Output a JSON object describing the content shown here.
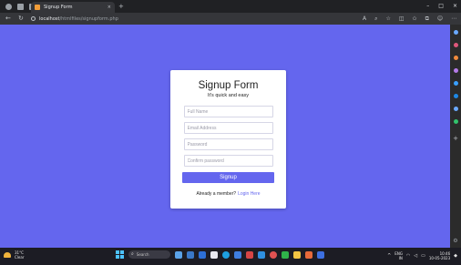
{
  "browser": {
    "tab_title": "Signup Form",
    "tab_close": "×",
    "new_tab": "+",
    "url_host": "localhost",
    "url_path": "/htmlfiles/signupform.php",
    "window_controls": [
      "–",
      "□",
      "×"
    ]
  },
  "form": {
    "title": "Signup Form",
    "subtitle": "It's quick and easy",
    "fullname_placeholder": "Full Name",
    "email_placeholder": "Email Address",
    "password_placeholder": "Password",
    "confirm_placeholder": "Confirm password",
    "submit_label": "Signup",
    "member_text": "Already a member?",
    "login_link": "Login Here",
    "accent_color": "#6466ee"
  },
  "taskbar": {
    "weather_temp": "31°C",
    "weather_desc": "Clear",
    "search_label": "Search",
    "lang": "ENG",
    "region": "IN",
    "time": "10:46",
    "date": "10-05-2023"
  }
}
